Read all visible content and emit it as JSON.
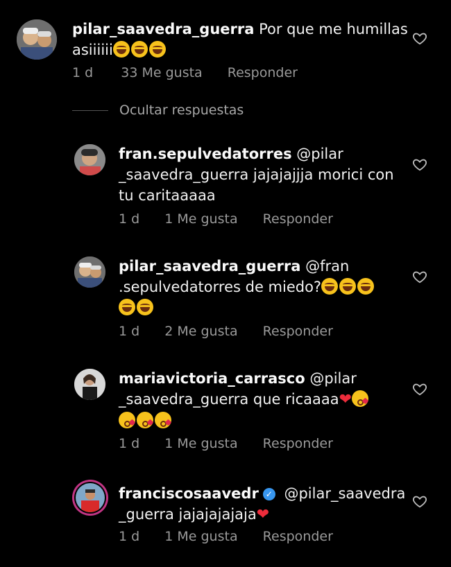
{
  "comments": [
    {
      "username": "pilar_saavedra_guerra",
      "text_line1": " Por que me humillas",
      "text_line2": "asiiiiii",
      "emoji_names": [
        "laughing-emoji",
        "laughing-emoji",
        "laughing-emoji"
      ],
      "time": "1 d",
      "likes": "33 Me gusta",
      "reply": "Responder"
    },
    {
      "username": "fran.sepulvedatorres",
      "text_line1": " @pilar",
      "text_line2": "_saavedra_guerra jajajajjja morici con",
      "text_line3": "tu caritaaaaa",
      "time": "1 d",
      "likes": "1 Me gusta",
      "reply": "Responder"
    },
    {
      "username": "pilar_saavedra_guerra",
      "text_line1": " @fran",
      "text_line2": ".sepulvedatorres de miedo?",
      "emoji_names": [
        "laughing-emoji",
        "laughing-emoji",
        "laughing-emoji",
        "laughing-emoji",
        "laughing-emoji"
      ],
      "time": "1 d",
      "likes": "2 Me gusta",
      "reply": "Responder"
    },
    {
      "username": "mariavictoria_carrasco",
      "text_line1": " @pilar",
      "text_line2": "_saavedra_guerra que ricaaaa",
      "emoji_names": [
        "red-heart-emoji",
        "kissing-emoji",
        "kissing-emoji",
        "kissing-emoji",
        "kissing-emoji"
      ],
      "time": "1 d",
      "likes": "1 Me gusta",
      "reply": "Responder"
    },
    {
      "username": "franciscosaavedr",
      "verified": true,
      "text_line1": " @pilar_saavedra",
      "text_line2": "_guerra jajajajajaja",
      "emoji_names": [
        "red-heart-emoji"
      ],
      "time": "1 d",
      "likes": "1 Me gusta",
      "reply": "Responder"
    }
  ],
  "hide_replies_label": "Ocultar respuestas",
  "colors": {
    "background": "#000000",
    "text": "#f2f2f2",
    "meta": "#9a9a9a",
    "verified": "#3897f0",
    "heart": "#ed2c3b"
  }
}
